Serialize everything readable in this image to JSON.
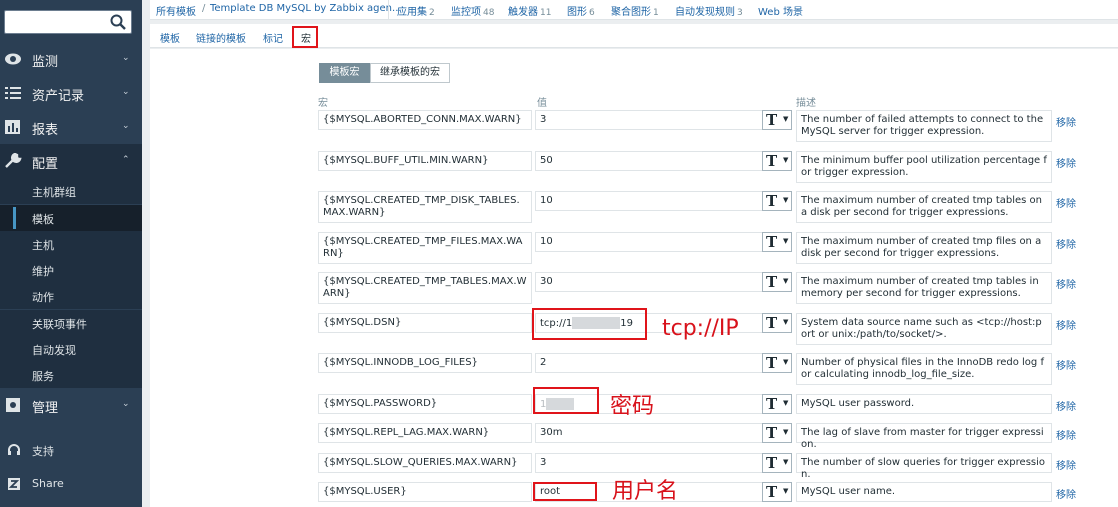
{
  "sidebar": {
    "search_placeholder": "",
    "menus": [
      {
        "label": "监测",
        "icon": "eye-icon"
      },
      {
        "label": "资产记录",
        "icon": "list-icon"
      },
      {
        "label": "报表",
        "icon": "bar-chart-icon"
      },
      {
        "label": "配置",
        "icon": "wrench-icon"
      },
      {
        "label": "管理",
        "icon": "gear-icon"
      }
    ],
    "config_items": [
      "主机群组",
      "模板",
      "主机",
      "维护",
      "动作",
      "关联项事件",
      "自动发现",
      "服务"
    ],
    "support": "支持",
    "share": "Share"
  },
  "topnav": {
    "all_templates": "所有模板",
    "template": "Template DB MySQL by Zabbix agen...",
    "apps": "应用集",
    "apps_count": "2",
    "items": "监控项",
    "items_count": "48",
    "triggers": "触发器",
    "triggers_count": "11",
    "graphs": "图形",
    "graphs_count": "6",
    "screens": "聚合图形",
    "screens_count": "1",
    "discovery": "自动发现规则",
    "discovery_count": "3",
    "web": "Web 场景"
  },
  "tabs": [
    "模板",
    "链接的模板",
    "标记",
    "宏"
  ],
  "subtabs": [
    "模板宏",
    "继承模板的宏"
  ],
  "columns": {
    "macro": "宏",
    "value": "值",
    "description": "描述"
  },
  "remove_label": "移除",
  "type_label": "T",
  "macros": [
    {
      "macro": "{$MYSQL.ABORTED_CONN.MAX.WARN}",
      "value": "3",
      "description": "The number of failed attempts to connect to the MySQL server for trigger expression."
    },
    {
      "macro": "{$MYSQL.BUFF_UTIL.MIN.WARN}",
      "value": "50",
      "description": "The minimum buffer pool utilization percentage for trigger expression."
    },
    {
      "macro": "{$MYSQL.CREATED_TMP_DISK_TABLES.MAX.WARN}",
      "value": "10",
      "description": "The maximum number of created tmp tables on a disk per second for trigger expressions."
    },
    {
      "macro": "{$MYSQL.CREATED_TMP_FILES.MAX.WARN}",
      "value": "10",
      "description": "The maximum number of created tmp files on a disk per second for trigger expressions."
    },
    {
      "macro": "{$MYSQL.CREATED_TMP_TABLES.MAX.WARN}",
      "value": "30",
      "description": "The maximum number of created tmp tables in memory per second for trigger expressions."
    },
    {
      "macro": "{$MYSQL.DSN}",
      "value_prefix": "tcp://1",
      "value_suffix": "19",
      "description": "System data source name such as <tcp://host:port or unix:/path/to/socket/>."
    },
    {
      "macro": "{$MYSQL.INNODB_LOG_FILES}",
      "value": "2",
      "description": "Number of physical files in the InnoDB redo log for calculating innodb_log_file_size."
    },
    {
      "macro": "{$MYSQL.PASSWORD}",
      "value_prefix": "1",
      "description": "MySQL user password."
    },
    {
      "macro": "{$MYSQL.REPL_LAG.MAX.WARN}",
      "value": "30m",
      "description": "The lag of slave from master for trigger expression."
    },
    {
      "macro": "{$MYSQL.SLOW_QUERIES.MAX.WARN}",
      "value": "3",
      "description": "The number of slow queries for trigger expression."
    },
    {
      "macro": "{$MYSQL.USER}",
      "value": "root",
      "description": "MySQL user name."
    }
  ],
  "annotations": {
    "ip": "tcp://IP",
    "password": "密码",
    "username": "用户名"
  },
  "colors": {
    "sidebar": "#2b3f54",
    "link": "#1f65a6",
    "annotation": "#d8121b"
  }
}
